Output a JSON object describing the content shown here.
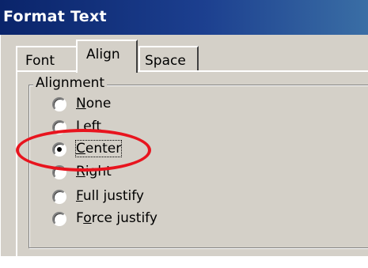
{
  "window": {
    "title": "Format Text"
  },
  "tabs": [
    {
      "label": "Font",
      "accel": ""
    },
    {
      "label": "Align",
      "accel": ""
    },
    {
      "label": "Space",
      "accel": ""
    }
  ],
  "active_tab": "Align",
  "alignment_group": {
    "legend": "Alignment",
    "options": [
      {
        "accel": "N",
        "rest": "one",
        "checked": false
      },
      {
        "accel": "L",
        "rest": "eft",
        "checked": false
      },
      {
        "accel": "C",
        "rest": "enter",
        "checked": true
      },
      {
        "accel": "R",
        "rest": "ight",
        "checked": false
      },
      {
        "accel": "F",
        "rest": "ull justify",
        "checked": false
      },
      {
        "pre": "F",
        "accel": "o",
        "rest": "rce justify",
        "checked": false
      }
    ],
    "selected": "Center"
  },
  "annotation": {
    "shape": "ellipse",
    "color": "#e8141e",
    "target": "Center"
  },
  "colors": {
    "face": "#d4d0c8",
    "titlebar": "#0a246a",
    "highlight": "#ffffff",
    "shadow": "#808080"
  }
}
